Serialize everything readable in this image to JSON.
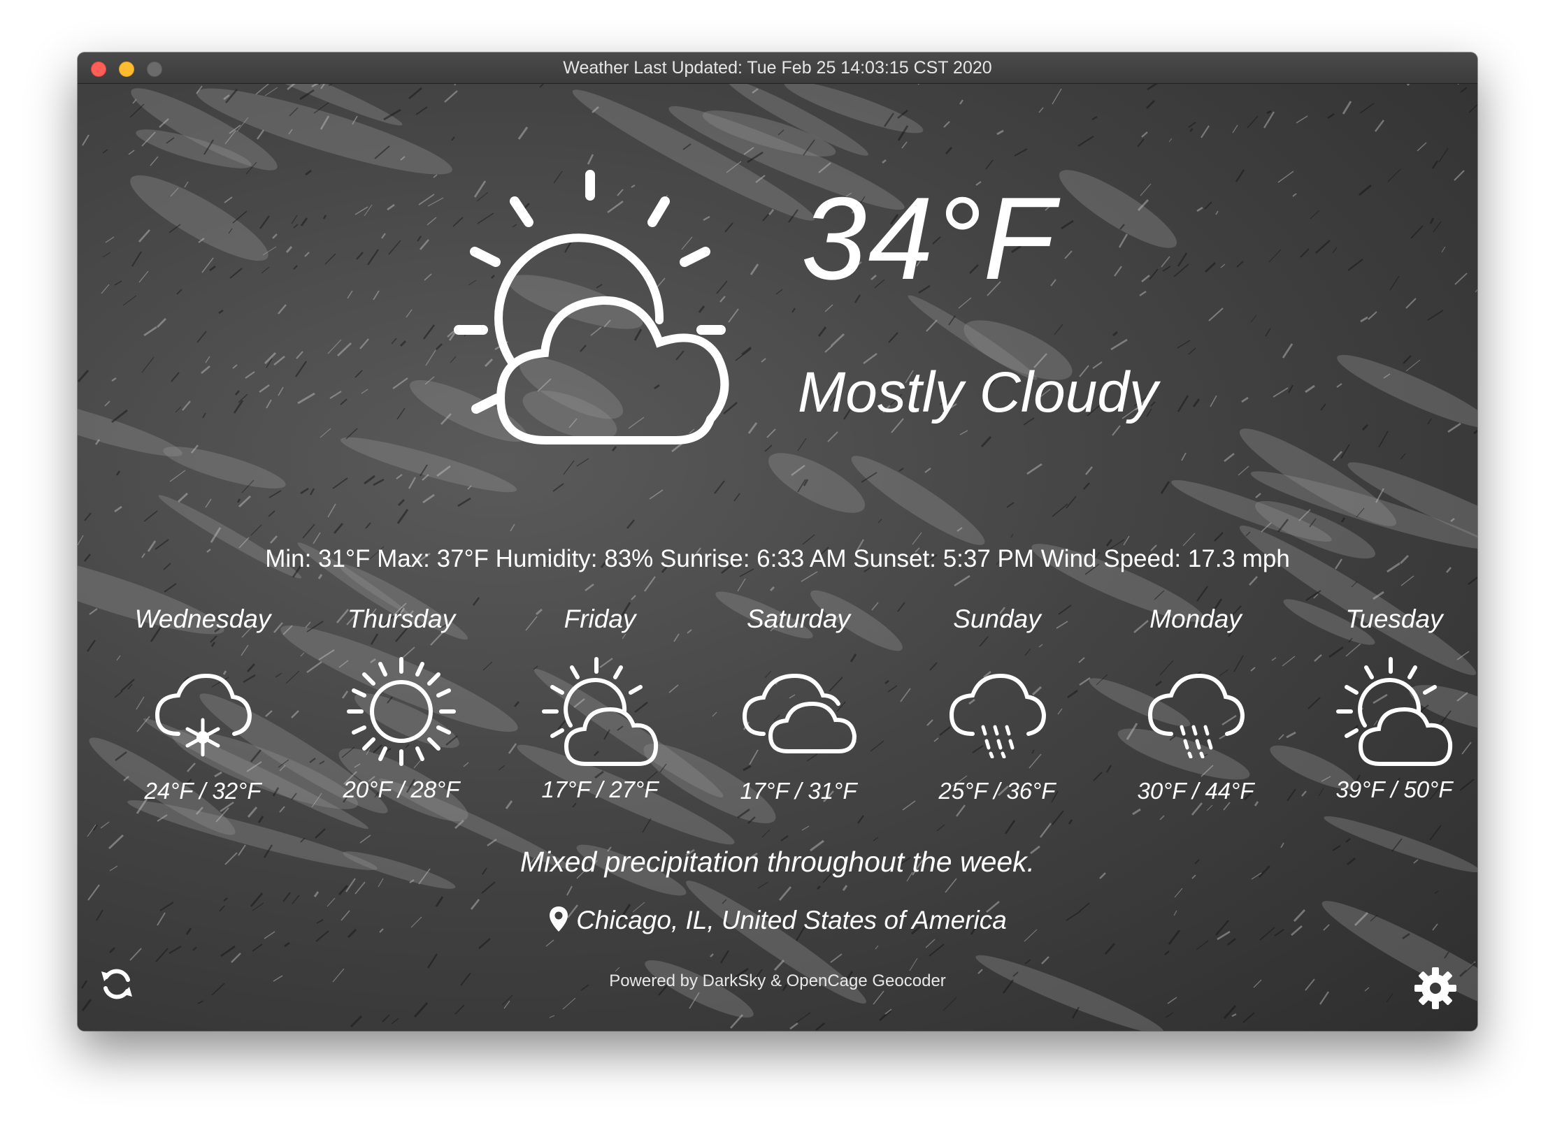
{
  "window": {
    "title": "Weather Last Updated: Tue Feb 25 14:03:15 CST 2020"
  },
  "current": {
    "temperature": "34°F",
    "condition": "Mostly Cloudy",
    "icon": "partly-cloudy-day-icon",
    "details": "Min: 31°F Max: 37°F Humidity: 83% Sunrise: 6:33 AM Sunset: 5:37 PM Wind Speed: 17.3 mph"
  },
  "forecast": [
    {
      "day": "Wednesday",
      "range": "24°F / 32°F",
      "icon": "snow-cloud-icon"
    },
    {
      "day": "Thursday",
      "range": "20°F / 28°F",
      "icon": "sun-icon"
    },
    {
      "day": "Friday",
      "range": "17°F / 27°F",
      "icon": "partly-cloudy-icon"
    },
    {
      "day": "Saturday",
      "range": "17°F / 31°F",
      "icon": "cloudy-icon"
    },
    {
      "day": "Sunday",
      "range": "25°F / 36°F",
      "icon": "rain-cloud-icon"
    },
    {
      "day": "Monday",
      "range": "30°F / 44°F",
      "icon": "rain-cloud-icon"
    },
    {
      "day": "Tuesday",
      "range": "39°F / 50°F",
      "icon": "partly-cloudy-icon"
    }
  ],
  "summary": "Mixed precipitation throughout the week.",
  "location": {
    "text": "Chicago, IL, United States of America",
    "icon": "map-pin-icon"
  },
  "footer": {
    "powered_by": "Powered by DarkSky & OpenCage Geocoder"
  },
  "controls": {
    "refresh_icon": "refresh-icon",
    "settings_icon": "gear-icon"
  },
  "colors": {
    "close": "#ff5f57",
    "minimize": "#febc2e",
    "maximize": "#6b6b6b",
    "text": "#ffffff"
  }
}
